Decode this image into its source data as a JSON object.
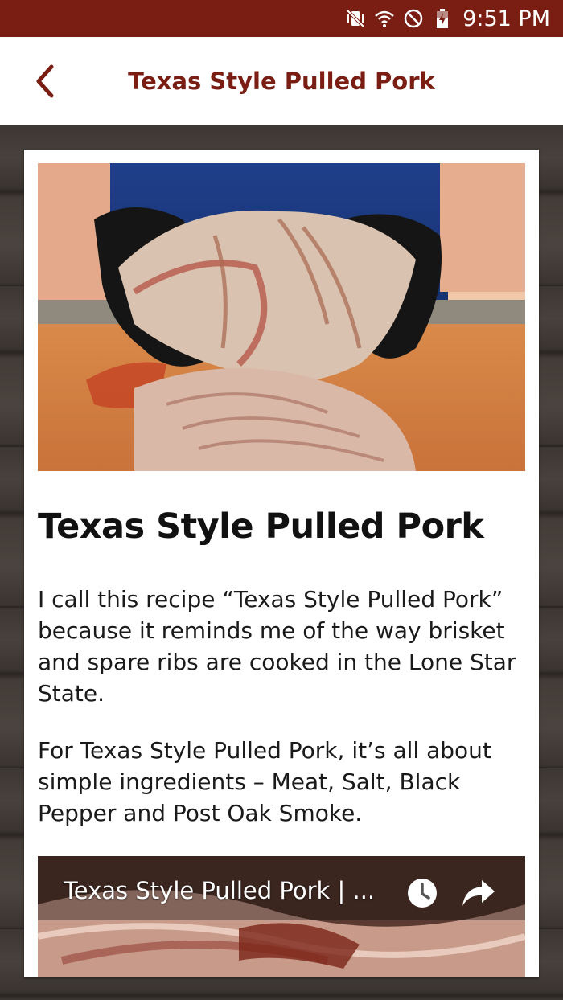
{
  "status_bar": {
    "time": "9:51 PM",
    "icons": [
      "vibrate-icon",
      "wifi-icon",
      "do-not-disturb-icon",
      "battery-icon"
    ]
  },
  "app_bar": {
    "title": "Texas Style Pulled Pork",
    "back_icon": "chevron-left-icon"
  },
  "colors": {
    "brand": "#7a1e14",
    "background_wood": "#3a3430",
    "card": "#ffffff"
  },
  "article": {
    "title": "Texas Style Pulled Pork",
    "paragraphs": [
      "I call this recipe “Texas Style Pulled Pork” because it reminds me of the way brisket and spare ribs are cooked in the Lone Star State.",
      "For Texas Style Pulled Pork, it’s all about simple ingredients – Meat, Salt, Black Pepper and Post Oak Smoke."
    ]
  },
  "video": {
    "title": "Texas Style Pulled Pork | ...",
    "icons": [
      "watch-later-icon",
      "share-icon"
    ]
  }
}
